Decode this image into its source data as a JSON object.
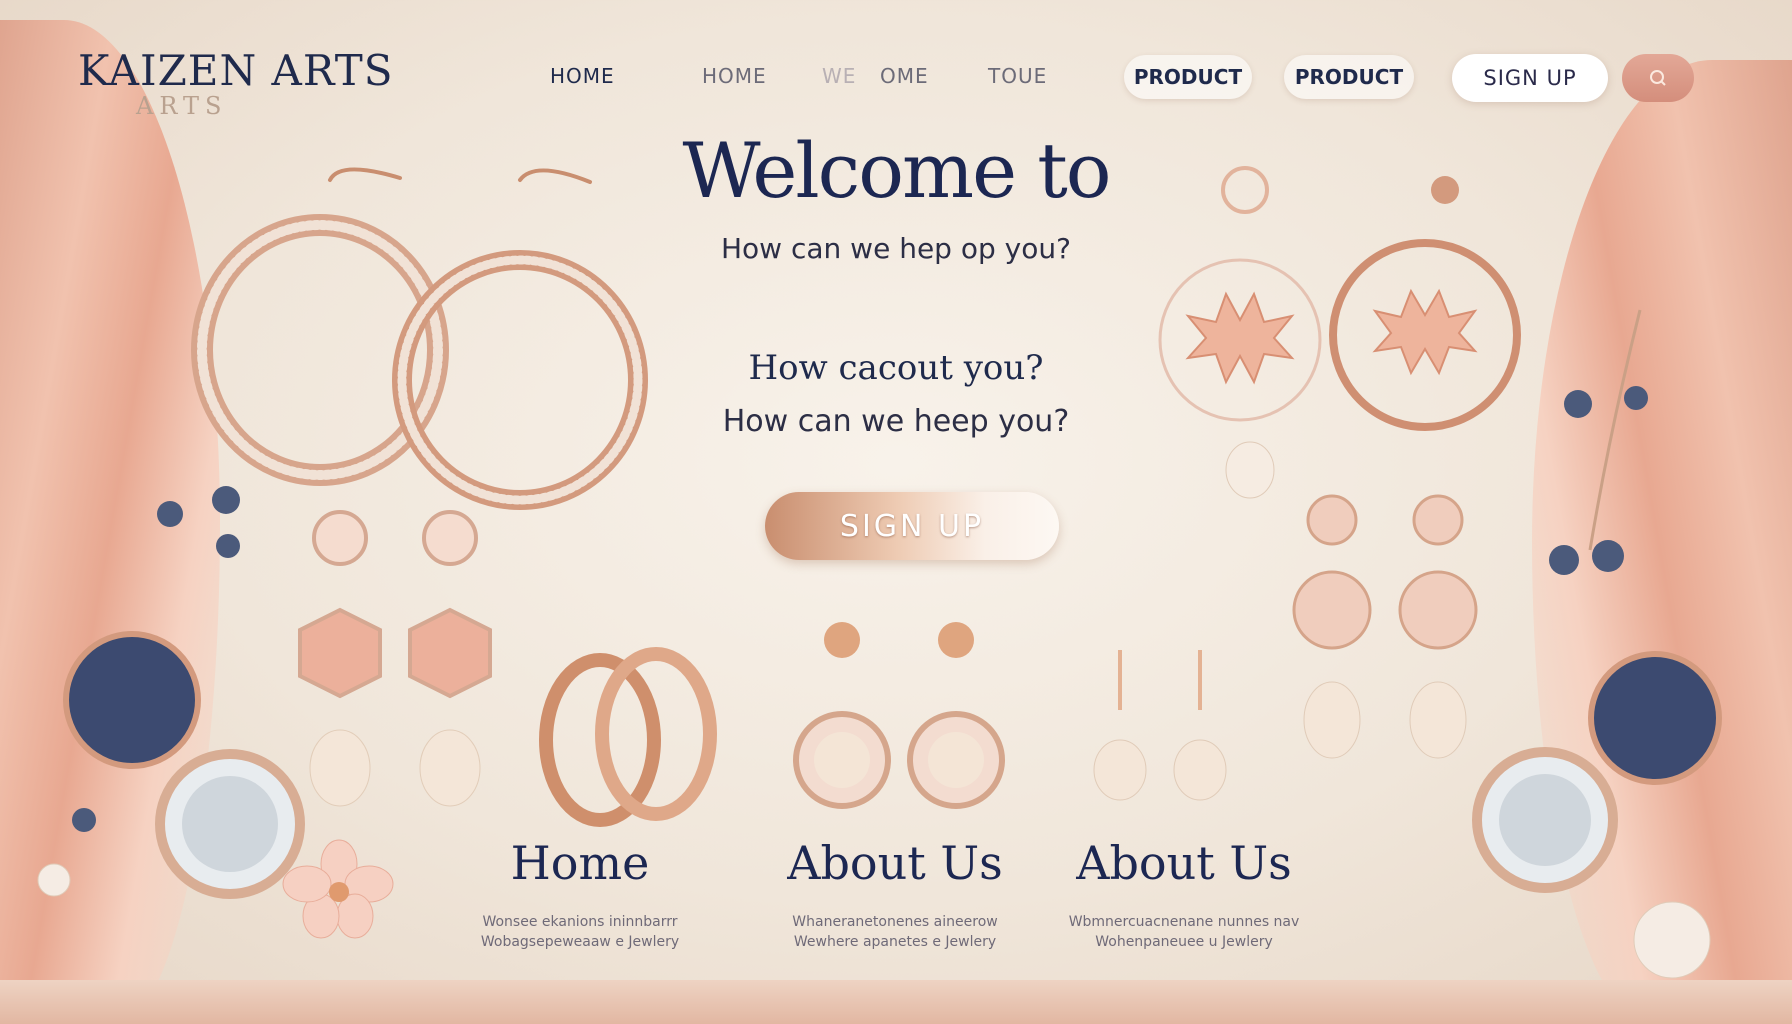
{
  "brand": {
    "name": "KAIZEN ARTS",
    "sub": "ARTS"
  },
  "nav": {
    "links": [
      "HOME",
      "HOME",
      "WE",
      "OME",
      "TOUE"
    ],
    "pills": [
      "PRODUCT",
      "PRODUCT"
    ],
    "signup": "SIGN UP",
    "search_icon": "search-icon"
  },
  "hero": {
    "title": "Welcome to",
    "subtitle": "How can we hep  op you?",
    "line2": "How cacout you?",
    "line3": "How can we heep you?",
    "cta": "SIGN UP"
  },
  "sections": [
    {
      "title": "Home",
      "desc1": "Wonsee ekanions ininnbarrr",
      "desc2": "Wobagsepeweaaw e Jewlery"
    },
    {
      "title": "About Us",
      "desc1": "Whaneranetonenes aineerow",
      "desc2": "Wewhere apanetes e Jewlery"
    },
    {
      "title": "About Us",
      "desc1": "Wbmnercuacnenane nunnes nav",
      "desc2": "Wohenpaneuee u Jewlery"
    }
  ],
  "colors": {
    "navy": "#1c2752",
    "rose_gold": "#d39a7e",
    "cream": "#f4ece2",
    "pearl": "#f3e3d3"
  }
}
